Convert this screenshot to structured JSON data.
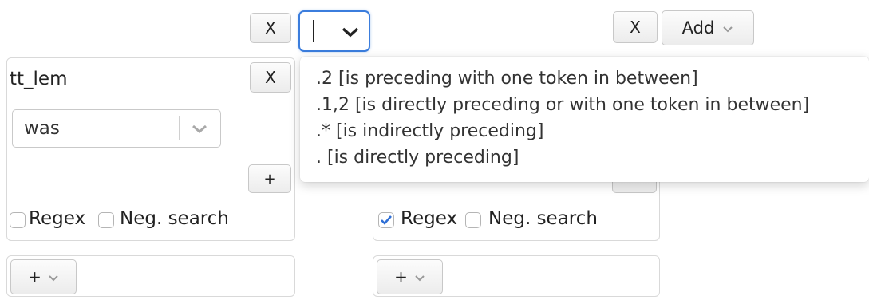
{
  "left_column": {
    "remove_label": "X",
    "token_box": {
      "key": "tt_lem",
      "remove_label": "X",
      "value": "was",
      "add_label": "+",
      "regex_label": "Regex",
      "regex_checked": false,
      "neg_label": "Neg. search",
      "neg_checked": false
    },
    "plus_label": "+"
  },
  "relation_select": {
    "value": "",
    "options": [
      ".2 [is preceding with one token in between]",
      ".1,2 [is directly preceding or with one token in between]",
      ".* [is indirectly preceding]",
      ". [is directly preceding]"
    ]
  },
  "right_column": {
    "remove_label": "X",
    "regex_label": "Regex",
    "regex_checked": true,
    "neg_label": "Neg. search",
    "neg_checked": false,
    "plus_label": "+"
  },
  "add_button": {
    "label": "Add"
  },
  "colors": {
    "accent": "#2f6fd6",
    "border": "#d9d9d9"
  }
}
